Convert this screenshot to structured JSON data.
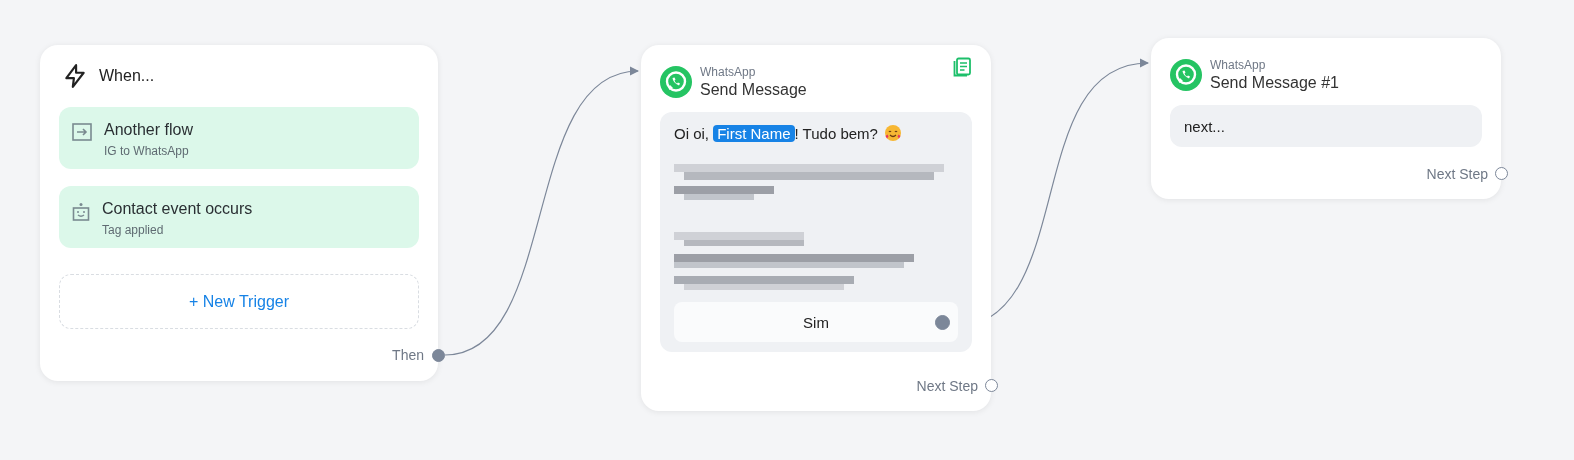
{
  "nodes": [
    {
      "kind": "trigger",
      "title": "When...",
      "triggers": [
        {
          "kind": "flow",
          "title": "Another flow",
          "subtitle": "IG to WhatsApp"
        },
        {
          "kind": "contact",
          "title": "Contact event occurs",
          "subtitle": "Tag applied"
        }
      ],
      "add_button": "+ New Trigger",
      "output": {
        "label": "Then",
        "connected": true
      }
    },
    {
      "kind": "message",
      "app": "WhatsApp",
      "title": "Send Message",
      "note_icon": true,
      "message": {
        "before": "Oi oi, ",
        "variable": "First Name",
        "after": "! Tudo bem?",
        "emoji": true,
        "blurred": true
      },
      "buttons": [
        {
          "label": "Sim",
          "connected": true
        }
      ],
      "output": {
        "label": "Next Step",
        "connected": false
      }
    },
    {
      "kind": "message",
      "app": "WhatsApp",
      "title": "Send Message #1",
      "message": {
        "before": "next..."
      },
      "output": {
        "label": "Next Step",
        "connected": false
      }
    }
  ]
}
